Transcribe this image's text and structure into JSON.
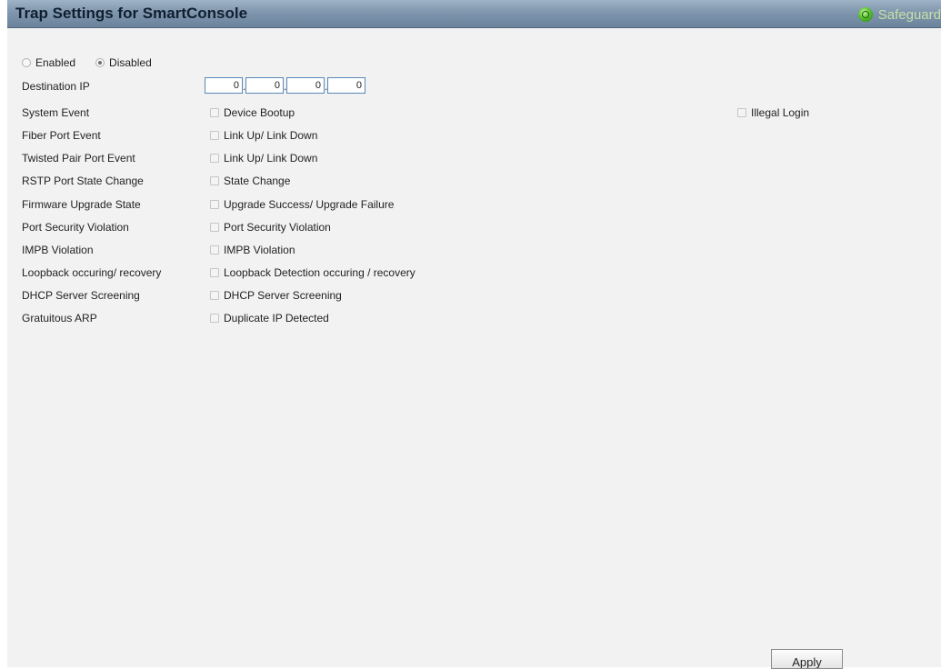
{
  "header": {
    "title": "Trap Settings for SmartConsole",
    "safeguard_label": "Safeguard"
  },
  "state": {
    "enabled_label": "Enabled",
    "disabled_label": "Disabled",
    "selected": "Disabled"
  },
  "destination_ip": {
    "label": "Destination IP",
    "octets": [
      "0",
      "0",
      "0",
      "0"
    ]
  },
  "events": [
    {
      "label": "System Event",
      "option": "Device Bootup"
    },
    {
      "label": "Fiber Port Event",
      "option": "Link Up/ Link Down"
    },
    {
      "label": "Twisted Pair Port Event",
      "option": "Link Up/ Link Down"
    },
    {
      "label": "RSTP Port State Change",
      "option": "State Change"
    },
    {
      "label": "Firmware Upgrade State",
      "option": "Upgrade Success/ Upgrade Failure"
    },
    {
      "label": "Port Security Violation",
      "option": "Port Security Violation"
    },
    {
      "label": "IMPB Violation",
      "option": "IMPB Violation"
    },
    {
      "label": "Loopback occuring/ recovery",
      "option": "Loopback Detection occuring / recovery"
    },
    {
      "label": "DHCP Server Screening",
      "option": "DHCP Server Screening"
    },
    {
      "label": "Gratuitous ARP",
      "option": "Duplicate IP Detected"
    }
  ],
  "extra_option": "Illegal Login",
  "apply_label": "Apply",
  "colors": {
    "title_bar": "#7f96ad",
    "panel_bg": "#f2f2f2",
    "ip_border": "#5a87b8",
    "safeguard_icon": "#58c22e"
  }
}
